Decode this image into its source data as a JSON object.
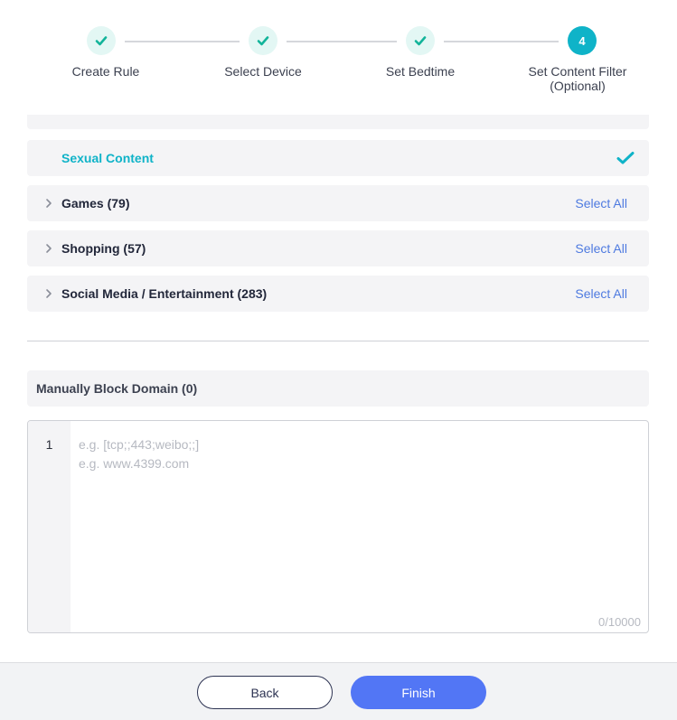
{
  "stepper": {
    "steps": [
      {
        "label": "Create Rule",
        "status": "done"
      },
      {
        "label": "Select Device",
        "status": "done"
      },
      {
        "label": "Set Bedtime",
        "status": "done"
      },
      {
        "label": "Set Content Filter (Optional)",
        "label_line1": "Set Content Filter",
        "label_line2": "(Optional)",
        "status": "active",
        "number": "4"
      }
    ],
    "accent_color": "#0fb3c8",
    "done_bg": "#e3f7f4"
  },
  "categories": [
    {
      "name": "Sexual Content",
      "selected": true,
      "icon": "checkmark-icon"
    },
    {
      "name": "Games (79)",
      "action": "Select All",
      "icon": "chevron-right-icon"
    },
    {
      "name": "Shopping (57)",
      "action": "Select All",
      "icon": "chevron-right-icon"
    },
    {
      "name": "Social Media / Entertainment (283)",
      "action": "Select All",
      "icon": "chevron-right-icon"
    }
  ],
  "manual_block": {
    "title": "Manually Block Domain (0)",
    "line_number": "1",
    "placeholder": "e.g. [tcp;;443;weibo;;]\ne.g. www.4399.com",
    "value": "",
    "counter": "0/10000"
  },
  "footer": {
    "back_label": "Back",
    "finish_label": "Finish",
    "finish_color": "#5276f5"
  }
}
